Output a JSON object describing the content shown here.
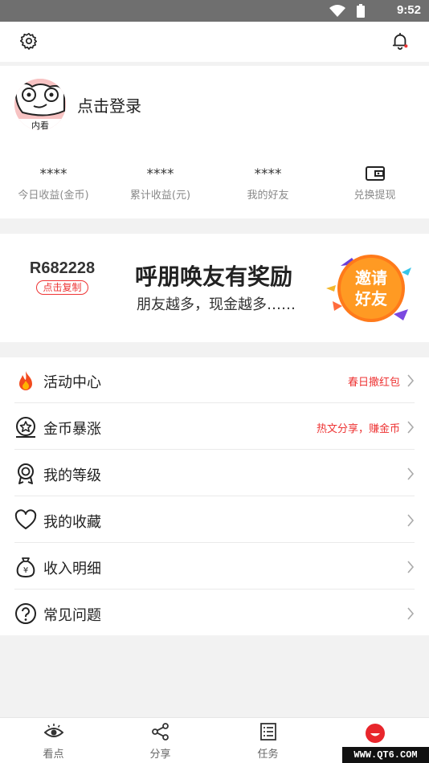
{
  "status_bar": {
    "time": "9:52"
  },
  "header": {
    "settings_icon": "gear-icon",
    "notification_icon": "bell-icon"
  },
  "profile": {
    "login_label": "点击登录",
    "avatar_text": "内看",
    "stats": [
      {
        "value": "****",
        "label": "今日收益(金币)"
      },
      {
        "value": "****",
        "label": "累计收益(元)"
      },
      {
        "value": "****",
        "label": "我的好友"
      },
      {
        "icon": "wallet-icon",
        "label": "兑换提现"
      }
    ]
  },
  "banner": {
    "invite_code": "R682228",
    "copy_label": "点击复制",
    "headline": "呼朋唤友有奖励",
    "subline": "朋友越多，现金越多……",
    "badge_line1": "邀请",
    "badge_line2": "好友"
  },
  "menu": [
    {
      "label": "活动中心",
      "note": "春日撒红包",
      "icon": "flame-icon"
    },
    {
      "label": "金币暴涨",
      "note": "热文分享，赚金币",
      "icon": "star-coin-icon"
    },
    {
      "label": "我的等级",
      "note": "",
      "icon": "medal-icon"
    },
    {
      "label": "我的收藏",
      "note": "",
      "icon": "heart-icon"
    },
    {
      "label": "收入明细",
      "note": "",
      "icon": "money-bag-icon"
    },
    {
      "label": "常见问题",
      "note": "",
      "icon": "question-icon"
    }
  ],
  "tabbar": [
    {
      "label": "看点",
      "icon": "eye-icon"
    },
    {
      "label": "分享",
      "icon": "share-icon"
    },
    {
      "label": "任务",
      "icon": "task-list-icon"
    },
    {
      "label": "",
      "icon": "profile-face-icon",
      "active": true
    }
  ],
  "watermark": "WWW.QT6.COM",
  "colors": {
    "accent": "#e33333",
    "note": "#e33333",
    "background": "#f2f2f2"
  }
}
